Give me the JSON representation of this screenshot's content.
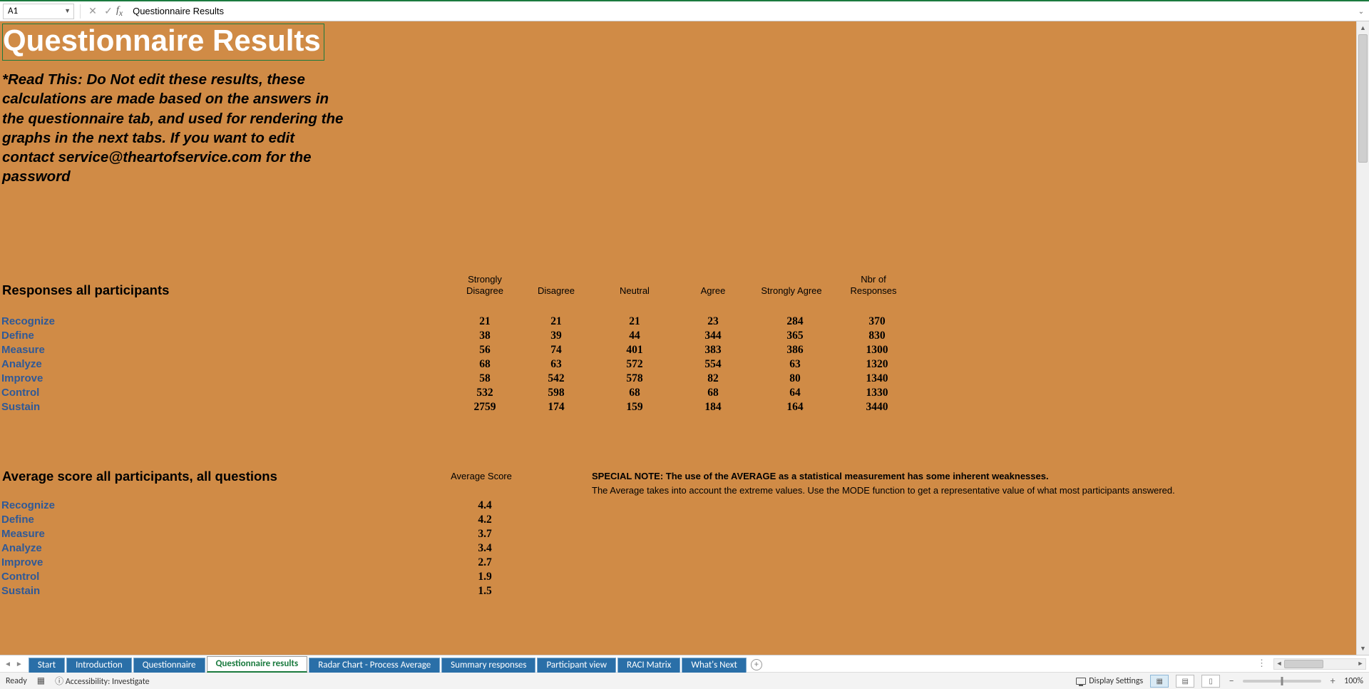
{
  "formula_bar": {
    "cell_ref": "A1",
    "formula": "Questionnaire Results"
  },
  "title": "Questionnaire Results",
  "warning": "*Read This: Do Not edit these results, these calculations are made based on the answers in the questionnaire tab, and used for rendering the graphs in the next tabs. If you want to edit contact service@theartofservice.com for the password",
  "section1_header": "Responses all participants",
  "columns": {
    "c1a": "Strongly",
    "c1b": "Disagree",
    "c2": "Disagree",
    "c3": "Neutral",
    "c4": "Agree",
    "c5": "Strongly Agree",
    "c6a": "Nbr of",
    "c6b": "Responses"
  },
  "row_labels": [
    "Recognize",
    "Define",
    "Measure",
    "Analyze",
    "Improve",
    "Control",
    "Sustain"
  ],
  "table1": [
    [
      "21",
      "21",
      "21",
      "23",
      "284",
      "370"
    ],
    [
      "38",
      "39",
      "44",
      "344",
      "365",
      "830"
    ],
    [
      "56",
      "74",
      "401",
      "383",
      "386",
      "1300"
    ],
    [
      "68",
      "63",
      "572",
      "554",
      "63",
      "1320"
    ],
    [
      "58",
      "542",
      "578",
      "82",
      "80",
      "1340"
    ],
    [
      "532",
      "598",
      "68",
      "68",
      "64",
      "1330"
    ],
    [
      "2759",
      "174",
      "159",
      "184",
      "164",
      "3440"
    ]
  ],
  "section2_header": "Average score all participants, all questions",
  "avg_col_header": "Average Score",
  "averages": [
    "4.4",
    "4.2",
    "3.7",
    "3.4",
    "2.7",
    "1.9",
    "1.5"
  ],
  "note_bold": "SPECIAL NOTE: The use of the AVERAGE as a statistical measurement has some inherent weaknesses.",
  "note_plain": "The Average takes into account the extreme values. Use the MODE function to get a representative value of what most participants answered.",
  "tabs": [
    "Start",
    "Introduction",
    "Questionnaire",
    "Questionnaire results",
    "Radar Chart - Process Average",
    "Summary responses",
    "Participant view",
    "RACI Matrix",
    "What's Next"
  ],
  "active_tab_index": 3,
  "status": {
    "ready": "Ready",
    "accessibility": "Accessibility: Investigate",
    "display_settings": "Display Settings",
    "zoom": "100%"
  },
  "chart_data": {
    "type": "table",
    "title": "Responses all participants",
    "columns": [
      "Strongly Disagree",
      "Disagree",
      "Neutral",
      "Agree",
      "Strongly Agree",
      "Nbr of Responses"
    ],
    "rows": [
      "Recognize",
      "Define",
      "Measure",
      "Analyze",
      "Improve",
      "Control",
      "Sustain"
    ],
    "values": [
      [
        21,
        21,
        21,
        23,
        284,
        370
      ],
      [
        38,
        39,
        44,
        344,
        365,
        830
      ],
      [
        56,
        74,
        401,
        383,
        386,
        1300
      ],
      [
        68,
        63,
        572,
        554,
        63,
        1320
      ],
      [
        58,
        542,
        578,
        82,
        80,
        1340
      ],
      [
        532,
        598,
        68,
        68,
        64,
        1330
      ],
      [
        2759,
        174,
        159,
        184,
        164,
        3440
      ]
    ],
    "averages_title": "Average score all participants, all questions",
    "averages": {
      "Recognize": 4.4,
      "Define": 4.2,
      "Measure": 3.7,
      "Analyze": 3.4,
      "Improve": 2.7,
      "Control": 1.9,
      "Sustain": 1.5
    }
  }
}
